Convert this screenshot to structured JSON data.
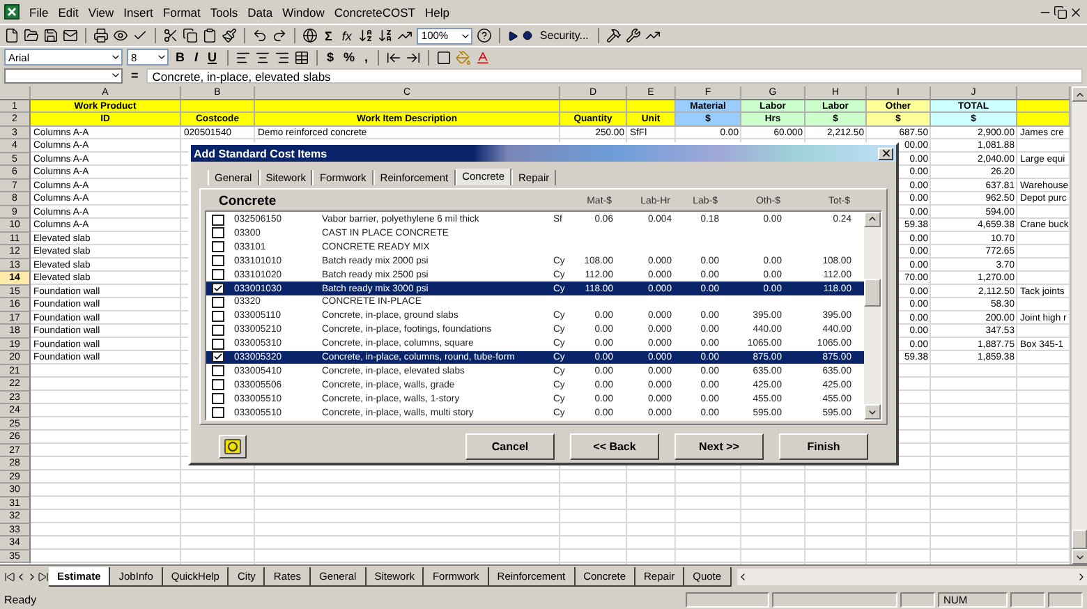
{
  "menu": [
    "File",
    "Edit",
    "View",
    "Insert",
    "Format",
    "Tools",
    "Data",
    "Window",
    "ConcreteCOST",
    "Help"
  ],
  "toolbar": {
    "zoom": "100%",
    "sigma": "Σ",
    "fx": "fx",
    "security": "Security..."
  },
  "format_toolbar": {
    "font": "Arial",
    "size": "8",
    "bold": "B",
    "italic": "I",
    "underline": "U",
    "currency": "$",
    "percent": "%",
    "comma": ","
  },
  "formula_bar": {
    "equals": "=",
    "value": "Concrete, in-place, elevated slabs"
  },
  "sheet": {
    "columns": [
      {
        "letter": "A",
        "color": "#ffff00"
      },
      {
        "letter": "B",
        "color": "#ffff00"
      },
      {
        "letter": "C",
        "color": "#ffff00"
      },
      {
        "letter": "D",
        "color": "#ffff00"
      },
      {
        "letter": "E",
        "color": "#ffff00"
      },
      {
        "letter": "F",
        "color": "#99ccff"
      },
      {
        "letter": "G",
        "color": "#ccffcc"
      },
      {
        "letter": "H",
        "color": "#ccffcc"
      },
      {
        "letter": "I",
        "color": "#ffff99"
      },
      {
        "letter": "J",
        "color": "#ccffff"
      },
      {
        "color": "#ffff00"
      }
    ],
    "rows": [
      {
        "number": "1",
        "kind": "header",
        "selected": false,
        "cells": {
          "A": "Work Product",
          "F": "Material",
          "G": "Labor",
          "H": "Labor",
          "I": "Other",
          "J": "TOTAL"
        }
      },
      {
        "number": "2",
        "kind": "header",
        "selected": false,
        "cells": {
          "A": "ID",
          "B": "Costcode",
          "C": "Work Item Description",
          "D": "Quantity",
          "E": "Unit",
          "F": "$",
          "G": "Hrs",
          "H": "$",
          "I": "$",
          "J": "$"
        }
      },
      {
        "number": "3",
        "kind": "data",
        "selected": false,
        "cells": {
          "A": "Columns A-A",
          "B": "020501540",
          "C": "Demo reinforced concrete",
          "D": "250.00",
          "E": "SfFl",
          "F": "0.00",
          "G": "60.000",
          "H": "2,212.50",
          "I": "687.50",
          "J": "2,900.00",
          "column_11": "James cre"
        }
      },
      {
        "number": "4",
        "kind": "data",
        "selected": false,
        "cells": {
          "A": "Columns A-A",
          "I": "00.00",
          "J": "1,081.88"
        }
      },
      {
        "number": "5",
        "kind": "data",
        "selected": false,
        "cells": {
          "A": "Columns A-A",
          "I": "0.00",
          "J": "2,040.00",
          "column_11": "Large equi"
        }
      },
      {
        "number": "6",
        "kind": "data",
        "selected": false,
        "cells": {
          "A": "Columns A-A",
          "I": "0.00",
          "J": "26.20"
        }
      },
      {
        "number": "7",
        "kind": "data",
        "selected": false,
        "cells": {
          "A": "Columns A-A",
          "I": "0.00",
          "J": "637.81",
          "column_11": "Warehouse"
        }
      },
      {
        "number": "8",
        "kind": "data",
        "selected": false,
        "cells": {
          "A": "Columns A-A",
          "I": "0.00",
          "J": "962.50",
          "column_11": "Depot purc"
        }
      },
      {
        "number": "9",
        "kind": "data",
        "selected": false,
        "cells": {
          "A": "Columns A-A",
          "I": "0.00",
          "J": "594.00"
        }
      },
      {
        "number": "10",
        "kind": "data",
        "selected": false,
        "cells": {
          "A": "Columns A-A",
          "I": "59.38",
          "J": "4,659.38",
          "column_11": "Crane buck"
        }
      },
      {
        "number": "11",
        "kind": "data",
        "selected": false,
        "cells": {
          "A": "Elevated slab",
          "I": "0.00",
          "J": "10.70"
        }
      },
      {
        "number": "12",
        "kind": "data",
        "selected": false,
        "cells": {
          "A": "Elevated slab",
          "I": "0.00",
          "J": "772.65"
        }
      },
      {
        "number": "13",
        "kind": "data",
        "selected": false,
        "cells": {
          "A": "Elevated slab",
          "I": "0.00",
          "J": "3.70"
        }
      },
      {
        "number": "14",
        "kind": "data",
        "selected": true,
        "cells": {
          "A": "Elevated slab",
          "I": "70.00",
          "J": "1,270.00"
        }
      },
      {
        "number": "15",
        "kind": "data",
        "selected": false,
        "cells": {
          "A": "Foundation wall",
          "I": "0.00",
          "J": "2,112.50",
          "column_11": "Tack joints"
        }
      },
      {
        "number": "16",
        "kind": "data",
        "selected": false,
        "cells": {
          "A": "Foundation wall",
          "I": "0.00",
          "J": "58.30"
        }
      },
      {
        "number": "17",
        "kind": "data",
        "selected": false,
        "cells": {
          "A": "Foundation wall",
          "I": "0.00",
          "J": "200.00",
          "column_11": "Joint high r"
        }
      },
      {
        "number": "18",
        "kind": "data",
        "selected": false,
        "cells": {
          "A": "Foundation wall",
          "I": "0.00",
          "J": "347.53"
        }
      },
      {
        "number": "19",
        "kind": "data",
        "selected": false,
        "cells": {
          "A": "Foundation wall",
          "I": "0.00",
          "J": "1,887.75",
          "column_11": "Box 345-1"
        }
      },
      {
        "number": "20",
        "kind": "data",
        "selected": false,
        "cells": {
          "A": "Foundation wall",
          "I": "59.38",
          "J": "1,859.38"
        }
      },
      {
        "number": "21",
        "kind": "data",
        "selected": false
      },
      {
        "number": "22",
        "kind": "data",
        "selected": false
      },
      {
        "number": "23",
        "kind": "data",
        "selected": false
      },
      {
        "number": "24",
        "kind": "data",
        "selected": false
      },
      {
        "number": "25",
        "kind": "data",
        "selected": false
      },
      {
        "number": "26",
        "kind": "data",
        "selected": false
      },
      {
        "number": "27",
        "kind": "data",
        "selected": false
      },
      {
        "number": "28",
        "kind": "data",
        "selected": false
      },
      {
        "number": "29",
        "kind": "data",
        "selected": false
      },
      {
        "number": "30",
        "kind": "data",
        "selected": false
      },
      {
        "number": "31",
        "kind": "data",
        "selected": false
      },
      {
        "number": "32",
        "kind": "data",
        "selected": false
      },
      {
        "number": "33",
        "kind": "data",
        "selected": false
      },
      {
        "number": "34",
        "kind": "data",
        "selected": false
      },
      {
        "number": "35",
        "kind": "data",
        "selected": false
      }
    ]
  },
  "dialog": {
    "title": "Add Standard Cost Items",
    "tabs": [
      {
        "label": "General",
        "selected": false
      },
      {
        "label": "Sitework",
        "selected": false
      },
      {
        "label": "Formwork",
        "selected": false
      },
      {
        "label": "Reinforcement",
        "selected": false
      },
      {
        "label": "Concrete",
        "selected": true
      },
      {
        "label": "Repair",
        "selected": false
      }
    ],
    "section": "Concrete",
    "columns": [
      "Mat-$",
      "Lab-Hr",
      "Lab-$",
      "Oth-$",
      "Tot-$"
    ],
    "items": [
      {
        "code": "032506150",
        "description": "Vabor barrier, polyethylene 6 mil thick",
        "unit": "Sf",
        "values": [
          "0.06",
          "0.004",
          "0.18",
          "0.00",
          "0.24"
        ],
        "checked": false,
        "selected": false
      },
      {
        "code": "03300",
        "description": "CAST IN PLACE CONCRETE",
        "checked": false,
        "selected": false
      },
      {
        "code": "033101",
        "description": "CONCRETE READY MIX",
        "checked": false,
        "selected": false
      },
      {
        "code": "033101010",
        "description": "Batch ready mix 2000 psi",
        "unit": "Cy",
        "values": [
          "108.00",
          "0.000",
          "0.00",
          "0.00",
          "108.00"
        ],
        "checked": false,
        "selected": false
      },
      {
        "code": "033101020",
        "description": "Batch ready mix 2500 psi",
        "unit": "Cy",
        "values": [
          "112.00",
          "0.000",
          "0.00",
          "0.00",
          "112.00"
        ],
        "checked": false,
        "selected": false
      },
      {
        "code": "033001030",
        "description": "Batch ready mix 3000 psi",
        "unit": "Cy",
        "values": [
          "118.00",
          "0.000",
          "0.00",
          "0.00",
          "118.00"
        ],
        "checked": true,
        "selected": true
      },
      {
        "code": "03320",
        "description": "CONCRETE IN-PLACE",
        "checked": false,
        "selected": false
      },
      {
        "code": "033005110",
        "description": "Concrete, in-place, ground slabs",
        "unit": "Cy",
        "values": [
          "0.00",
          "0.000",
          "0.00",
          "395.00",
          "395.00"
        ],
        "checked": false,
        "selected": false
      },
      {
        "code": "033005210",
        "description": "Concrete, in-place, footings, foundations",
        "unit": "Cy",
        "values": [
          "0.00",
          "0.000",
          "0.00",
          "440.00",
          "440.00"
        ],
        "checked": false,
        "selected": false
      },
      {
        "code": "033005310",
        "description": "Concrete, in-place, columns, square",
        "unit": "Cy",
        "values": [
          "0.00",
          "0.000",
          "0.00",
          "1065.00",
          "1065.00"
        ],
        "checked": false,
        "selected": false
      },
      {
        "code": "033005320",
        "description": "Concrete, in-place, columns, round, tube-form",
        "unit": "Cy",
        "values": [
          "0.00",
          "0.000",
          "0.00",
          "875.00",
          "875.00"
        ],
        "checked": true,
        "selected": true
      },
      {
        "code": "033005410",
        "description": "Concrete, in-place, elevated slabs",
        "unit": "Cy",
        "values": [
          "0.00",
          "0.000",
          "0.00",
          "635.00",
          "635.00"
        ],
        "checked": false,
        "selected": false
      },
      {
        "code": "033005506",
        "description": "Concrete, in-place, walls, grade",
        "unit": "Cy",
        "values": [
          "0.00",
          "0.000",
          "0.00",
          "425.00",
          "425.00"
        ],
        "checked": false,
        "selected": false
      },
      {
        "code": "033005510",
        "description": "Concrete, in-place, walls, 1-story",
        "unit": "Cy",
        "values": [
          "0.00",
          "0.000",
          "0.00",
          "455.00",
          "455.00"
        ],
        "checked": false,
        "selected": false
      },
      {
        "code": "033005510",
        "description": "Concrete, in-place, walls, multi story",
        "unit": "Cy",
        "values": [
          "0.00",
          "0.000",
          "0.00",
          "595.00",
          "595.00"
        ],
        "checked": false,
        "selected": false
      }
    ],
    "buttons": [
      "Cancel",
      "<< Back",
      "Next >>",
      "Finish"
    ]
  },
  "sheet_tabs": [
    {
      "label": "Estimate",
      "selected": true
    },
    {
      "label": "JobInfo",
      "selected": false
    },
    {
      "label": "QuickHelp",
      "selected": false
    },
    {
      "label": "City",
      "selected": false
    },
    {
      "label": "Rates",
      "selected": false
    },
    {
      "label": "General",
      "selected": false
    },
    {
      "label": "Sitework",
      "selected": false
    },
    {
      "label": "Formwork",
      "selected": false
    },
    {
      "label": "Reinforcement",
      "selected": false
    },
    {
      "label": "Concrete",
      "selected": false
    },
    {
      "label": "Repair",
      "selected": false
    },
    {
      "label": "Quote",
      "selected": false
    }
  ],
  "status_bar": {
    "text": "Ready",
    "num": "NUM"
  }
}
